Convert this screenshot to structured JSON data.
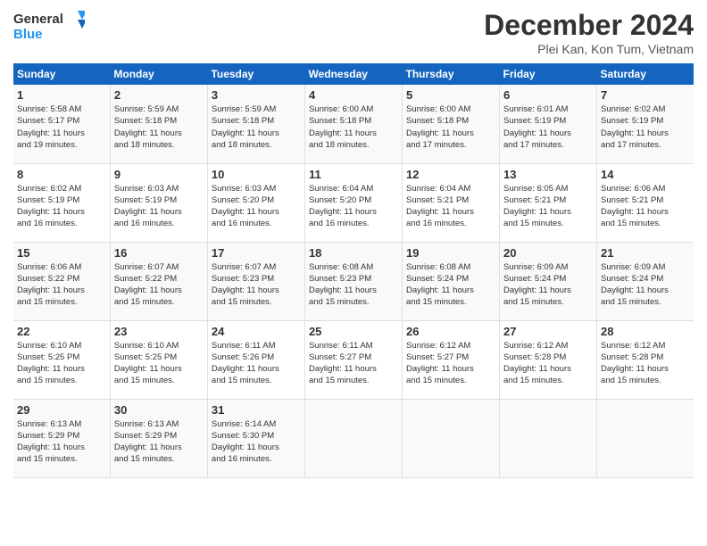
{
  "header": {
    "logo_line1": "General",
    "logo_line2": "Blue",
    "month_title": "December 2024",
    "location": "Plei Kan, Kon Tum, Vietnam"
  },
  "days_of_week": [
    "Sunday",
    "Monday",
    "Tuesday",
    "Wednesday",
    "Thursday",
    "Friday",
    "Saturday"
  ],
  "weeks": [
    [
      {
        "day": "1",
        "sunrise": "5:58 AM",
        "sunset": "5:17 PM",
        "daylight": "11 hours and 19 minutes."
      },
      {
        "day": "2",
        "sunrise": "5:59 AM",
        "sunset": "5:18 PM",
        "daylight": "11 hours and 18 minutes."
      },
      {
        "day": "3",
        "sunrise": "5:59 AM",
        "sunset": "5:18 PM",
        "daylight": "11 hours and 18 minutes."
      },
      {
        "day": "4",
        "sunrise": "6:00 AM",
        "sunset": "5:18 PM",
        "daylight": "11 hours and 18 minutes."
      },
      {
        "day": "5",
        "sunrise": "6:00 AM",
        "sunset": "5:18 PM",
        "daylight": "11 hours and 17 minutes."
      },
      {
        "day": "6",
        "sunrise": "6:01 AM",
        "sunset": "5:19 PM",
        "daylight": "11 hours and 17 minutes."
      },
      {
        "day": "7",
        "sunrise": "6:02 AM",
        "sunset": "5:19 PM",
        "daylight": "11 hours and 17 minutes."
      }
    ],
    [
      {
        "day": "8",
        "sunrise": "6:02 AM",
        "sunset": "5:19 PM",
        "daylight": "11 hours and 16 minutes."
      },
      {
        "day": "9",
        "sunrise": "6:03 AM",
        "sunset": "5:19 PM",
        "daylight": "11 hours and 16 minutes."
      },
      {
        "day": "10",
        "sunrise": "6:03 AM",
        "sunset": "5:20 PM",
        "daylight": "11 hours and 16 minutes."
      },
      {
        "day": "11",
        "sunrise": "6:04 AM",
        "sunset": "5:20 PM",
        "daylight": "11 hours and 16 minutes."
      },
      {
        "day": "12",
        "sunrise": "6:04 AM",
        "sunset": "5:21 PM",
        "daylight": "11 hours and 16 minutes."
      },
      {
        "day": "13",
        "sunrise": "6:05 AM",
        "sunset": "5:21 PM",
        "daylight": "11 hours and 15 minutes."
      },
      {
        "day": "14",
        "sunrise": "6:06 AM",
        "sunset": "5:21 PM",
        "daylight": "11 hours and 15 minutes."
      }
    ],
    [
      {
        "day": "15",
        "sunrise": "6:06 AM",
        "sunset": "5:22 PM",
        "daylight": "11 hours and 15 minutes."
      },
      {
        "day": "16",
        "sunrise": "6:07 AM",
        "sunset": "5:22 PM",
        "daylight": "11 hours and 15 minutes."
      },
      {
        "day": "17",
        "sunrise": "6:07 AM",
        "sunset": "5:23 PM",
        "daylight": "11 hours and 15 minutes."
      },
      {
        "day": "18",
        "sunrise": "6:08 AM",
        "sunset": "5:23 PM",
        "daylight": "11 hours and 15 minutes."
      },
      {
        "day": "19",
        "sunrise": "6:08 AM",
        "sunset": "5:24 PM",
        "daylight": "11 hours and 15 minutes."
      },
      {
        "day": "20",
        "sunrise": "6:09 AM",
        "sunset": "5:24 PM",
        "daylight": "11 hours and 15 minutes."
      },
      {
        "day": "21",
        "sunrise": "6:09 AM",
        "sunset": "5:24 PM",
        "daylight": "11 hours and 15 minutes."
      }
    ],
    [
      {
        "day": "22",
        "sunrise": "6:10 AM",
        "sunset": "5:25 PM",
        "daylight": "11 hours and 15 minutes."
      },
      {
        "day": "23",
        "sunrise": "6:10 AM",
        "sunset": "5:25 PM",
        "daylight": "11 hours and 15 minutes."
      },
      {
        "day": "24",
        "sunrise": "6:11 AM",
        "sunset": "5:26 PM",
        "daylight": "11 hours and 15 minutes."
      },
      {
        "day": "25",
        "sunrise": "6:11 AM",
        "sunset": "5:27 PM",
        "daylight": "11 hours and 15 minutes."
      },
      {
        "day": "26",
        "sunrise": "6:12 AM",
        "sunset": "5:27 PM",
        "daylight": "11 hours and 15 minutes."
      },
      {
        "day": "27",
        "sunrise": "6:12 AM",
        "sunset": "5:28 PM",
        "daylight": "11 hours and 15 minutes."
      },
      {
        "day": "28",
        "sunrise": "6:12 AM",
        "sunset": "5:28 PM",
        "daylight": "11 hours and 15 minutes."
      }
    ],
    [
      {
        "day": "29",
        "sunrise": "6:13 AM",
        "sunset": "5:29 PM",
        "daylight": "11 hours and 15 minutes."
      },
      {
        "day": "30",
        "sunrise": "6:13 AM",
        "sunset": "5:29 PM",
        "daylight": "11 hours and 15 minutes."
      },
      {
        "day": "31",
        "sunrise": "6:14 AM",
        "sunset": "5:30 PM",
        "daylight": "11 hours and 16 minutes."
      },
      null,
      null,
      null,
      null
    ]
  ]
}
